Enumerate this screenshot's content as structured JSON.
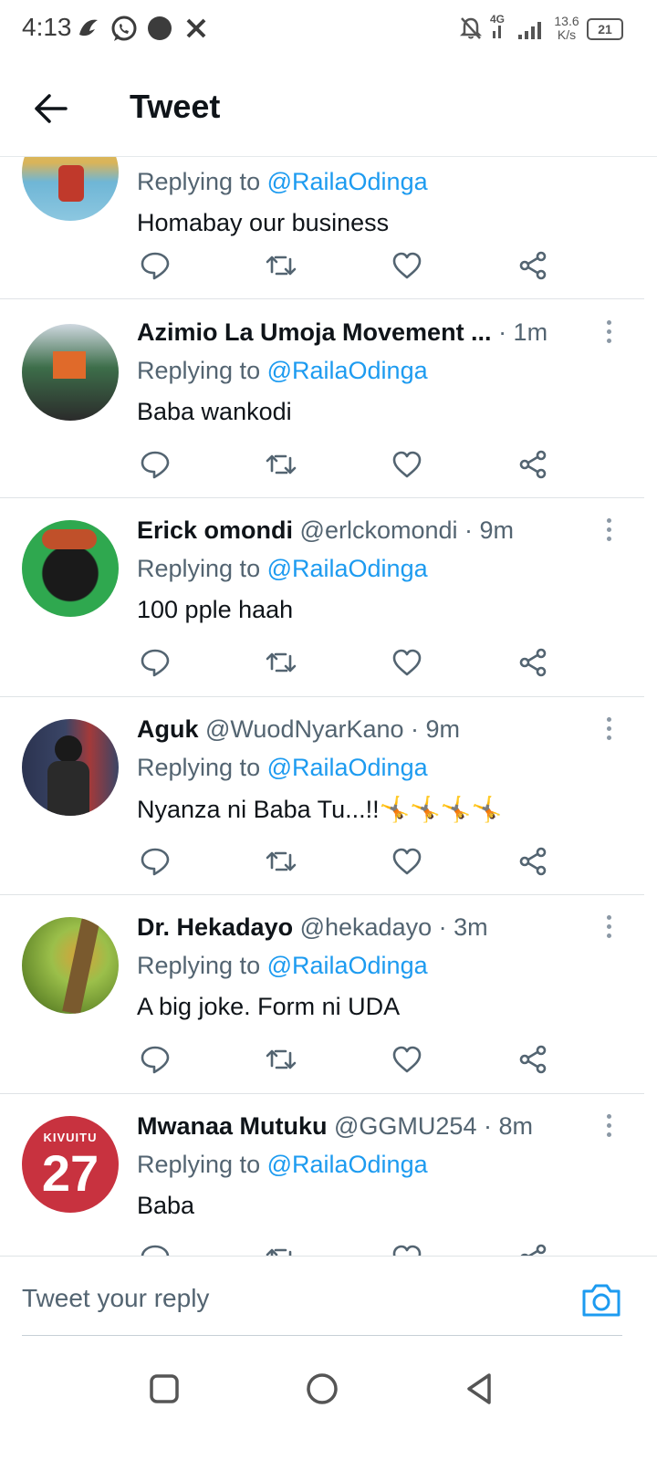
{
  "status_bar": {
    "time": "4:13",
    "network_type": "4G",
    "speed_value": "13.6",
    "speed_unit": "K/s",
    "battery": "21",
    "icons": [
      "snapchat-style-icon",
      "whatsapp-icon",
      "circle-icon",
      "x-icon",
      "mute-icon",
      "signal-icon",
      "battery-icon"
    ]
  },
  "header": {
    "title": "Tweet"
  },
  "replies": [
    {
      "name": "",
      "handle": "",
      "time": "",
      "replying_label": "Replying to ",
      "mention": "@RailaOdinga",
      "text": "Homabay our business",
      "avatar_colors": [
        "#e3c15f",
        "#6fb6d6"
      ]
    },
    {
      "name": "Azimio La Umoja Movement ...",
      "handle": "",
      "time": " · 1m",
      "replying_label": "Replying to ",
      "mention": "@RailaOdinga",
      "text": "Baba wankodi",
      "avatar_colors": [
        "#3d6e4a",
        "#e06a2a"
      ]
    },
    {
      "name": "Erick omondi",
      "handle": " @erlckomondi",
      "time": " · 9m",
      "replying_label": "Replying to ",
      "mention": "@RailaOdinga",
      "text": "100 pple haah",
      "avatar_colors": [
        "#2fa84f",
        "#1a1a1a"
      ]
    },
    {
      "name": "Aguk",
      "handle": " @WuodNyarKano",
      "time": " · 9m",
      "replying_label": "Replying to ",
      "mention": "@RailaOdinga",
      "text": "Nyanza ni Baba Tu...!!🤸🤸🤸🤸",
      "avatar_colors": [
        "#2b3350",
        "#a33a3a"
      ]
    },
    {
      "name": "Dr. Hekadayo",
      "handle": " @hekadayo",
      "time": " · 3m",
      "replying_label": "Replying to ",
      "mention": "@RailaOdinga",
      "text": "A big joke. Form ni UDA",
      "avatar_colors": [
        "#9bbf4a",
        "#d9a23a"
      ]
    },
    {
      "name": "Mwanaa Mutuku",
      "handle": " @GGMU254",
      "time": " · 8m",
      "replying_label": "Replying to ",
      "mention": "@RailaOdinga",
      "text": "Baba",
      "avatar_colors": [
        "#c8323f",
        "#ffffff"
      ],
      "avatar_jersey_name": "KIVUITU",
      "avatar_jersey_number": "27"
    }
  ],
  "actions": [
    "reply-icon",
    "retweet-icon",
    "like-icon",
    "share-icon"
  ],
  "composer": {
    "placeholder": "Tweet your reply"
  },
  "colors": {
    "accent": "#1d9bf0",
    "text_primary": "#0f1419",
    "text_secondary": "#536471"
  }
}
